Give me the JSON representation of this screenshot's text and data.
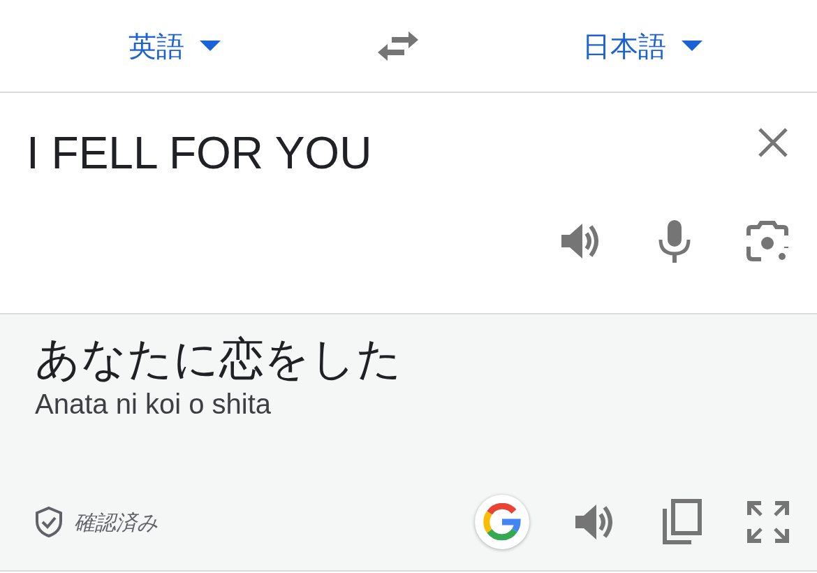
{
  "languages": {
    "source": "英語",
    "target": "日本語"
  },
  "input": {
    "value": "I FELL FOR YOU"
  },
  "result": {
    "translation": "あなたに恋をした",
    "romanization": "Anata ni koi o shita",
    "badge": "確認済み"
  }
}
